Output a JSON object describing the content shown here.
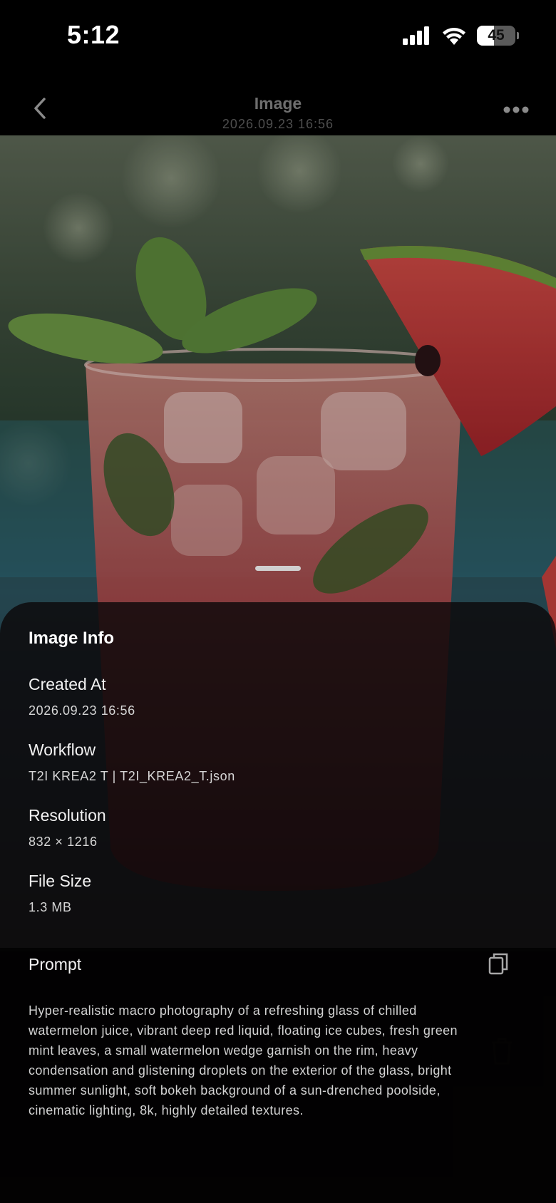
{
  "status_bar": {
    "time": "5:12",
    "battery_level": "45",
    "battery_fraction": 0.45
  },
  "header": {
    "title": "Image",
    "subtitle": "2026.09.23 16:56"
  },
  "image_info": {
    "title": "Image Info",
    "fields": [
      {
        "label": "Created At",
        "value": "2026.09.23 16:56"
      },
      {
        "label": "Workflow",
        "value": "T2I KREA2 T | T2I_KREA2_T.json"
      },
      {
        "label": "Resolution",
        "value": "832 × 1216"
      },
      {
        "label": "File Size",
        "value": "1.3 MB"
      }
    ]
  },
  "prompt": {
    "label": "Prompt",
    "lines": [
      "Hyper-realistic macro photography of a refreshing glass of chilled",
      "watermelon juice, vibrant deep red liquid, floating ice cubes, fresh green",
      "mint leaves, a small watermelon wedge garnish on the rim, heavy",
      "condensation and glistening droplets on the exterior of the glass, bright",
      "summer sunlight, soft bokeh background of a sun-drenched poolside,",
      "cinematic lighting, 8k, highly detailed textures."
    ]
  },
  "icons": {
    "back": "chevron-left-icon",
    "more": "ellipsis-icon",
    "copy": "copy-icon",
    "toolbar": [
      "share-icon",
      "heart-icon",
      "info-icon",
      "crop-icon",
      "trash-icon"
    ]
  },
  "colors": {
    "background": "#000000",
    "sheet": "#0c090a",
    "text_primary": "#ffffff",
    "text_secondary": "#d6d6d6"
  }
}
